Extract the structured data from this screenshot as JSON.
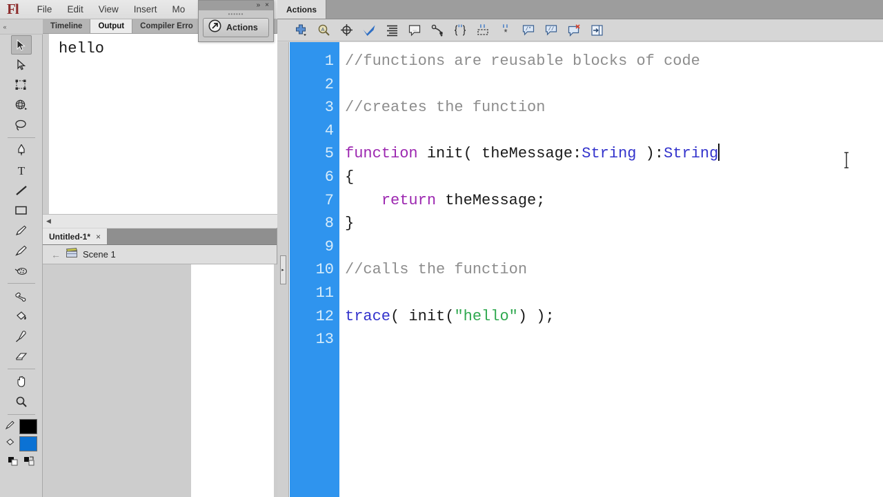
{
  "app": {
    "logo": "Fl",
    "menus": [
      "File",
      "Edit",
      "View",
      "Insert",
      "Mo"
    ]
  },
  "toolbox": {
    "collapse_label": "«",
    "tools": [
      {
        "name": "selection-tool",
        "label": "Selection Tool",
        "active": true
      },
      {
        "name": "subselection-tool",
        "label": "Subselection Tool",
        "active": false
      },
      {
        "name": "free-transform-tool",
        "label": "Free Transform Tool",
        "active": false
      },
      {
        "name": "3d-rotation-tool",
        "label": "3D Rotation Tool",
        "active": false
      },
      {
        "name": "lasso-tool",
        "label": "Lasso Tool",
        "active": false
      },
      {
        "name": "pen-tool",
        "label": "Pen Tool",
        "active": false
      },
      {
        "name": "text-tool",
        "label": "Text Tool",
        "active": false
      },
      {
        "name": "line-tool",
        "label": "Line Tool",
        "active": false
      },
      {
        "name": "rectangle-tool",
        "label": "Rectangle Tool",
        "active": false
      },
      {
        "name": "pencil-tool",
        "label": "Pencil Tool",
        "active": false
      },
      {
        "name": "brush-tool",
        "label": "Brush Tool",
        "active": false
      },
      {
        "name": "spray-brush-tool",
        "label": "Spray Brush Tool",
        "active": false
      },
      {
        "name": "bone-tool",
        "label": "Bone Tool",
        "active": false
      },
      {
        "name": "paint-bucket-tool",
        "label": "Paint Bucket Tool",
        "active": false
      },
      {
        "name": "eyedropper-tool",
        "label": "Eyedropper Tool",
        "active": false
      },
      {
        "name": "eraser-tool",
        "label": "Eraser Tool",
        "active": false
      },
      {
        "name": "hand-tool",
        "label": "Hand Tool",
        "active": false
      },
      {
        "name": "zoom-tool",
        "label": "Zoom Tool",
        "active": false
      }
    ],
    "colors": {
      "stroke_label": "Stroke color",
      "stroke_hex": "#000000",
      "fill_label": "Fill color",
      "fill_hex": "#0b72d4"
    }
  },
  "panel_group": {
    "tabs": [
      {
        "label": "Timeline",
        "active": false
      },
      {
        "label": "Output",
        "active": true
      },
      {
        "label": "Compiler Erro",
        "active": false
      }
    ],
    "output_text": "hello",
    "hscroll_arrow": "◀"
  },
  "document": {
    "tab_label": "Untitled-1*",
    "tab_close": "×",
    "back_arrow": "←",
    "scene_label": "Scene 1"
  },
  "float_panel": {
    "expand_label": "»",
    "close_label": "×",
    "grip": "••••••",
    "action_label": "Actions"
  },
  "actions": {
    "tab_label": "Actions",
    "toolbar": [
      {
        "name": "add-item-icon",
        "label": "Add a new item to the script"
      },
      {
        "name": "find-icon",
        "label": "Find"
      },
      {
        "name": "insert-target-path-icon",
        "label": "Insert target path"
      },
      {
        "name": "check-syntax-icon",
        "label": "Check syntax"
      },
      {
        "name": "auto-format-icon",
        "label": "Auto format"
      },
      {
        "name": "show-code-hint-icon",
        "label": "Show code hint"
      },
      {
        "name": "debug-options-icon",
        "label": "Debug options"
      },
      {
        "name": "collapse-between-braces-icon",
        "label": "Collapse between braces"
      },
      {
        "name": "collapse-selection-icon",
        "label": "Collapse selection"
      },
      {
        "name": "expand-all-icon",
        "label": "Expand all"
      },
      {
        "name": "apply-block-comment-icon",
        "label": "Apply block comment"
      },
      {
        "name": "apply-line-comment-icon",
        "label": "Apply line comment"
      },
      {
        "name": "remove-comment-icon",
        "label": "Remove comment"
      },
      {
        "name": "show-toolbox-icon",
        "label": "Show/Hide Toolbox"
      }
    ],
    "splitter_arrow": "▸",
    "line_numbers": [
      "1",
      "2",
      "3",
      "4",
      "5",
      "6",
      "7",
      "8",
      "9",
      "10",
      "11",
      "12",
      "13"
    ],
    "code_lines": [
      [
        {
          "t": "//functions are reusable blocks of code",
          "c": "cmt"
        }
      ],
      [],
      [
        {
          "t": "//creates the function",
          "c": "cmt"
        }
      ],
      [],
      [
        {
          "t": "function",
          "c": "kw"
        },
        {
          "t": " init( theMessage:",
          "c": "pln"
        },
        {
          "t": "String",
          "c": "typ"
        },
        {
          "t": " ):",
          "c": "pln"
        },
        {
          "t": "String",
          "c": "typ"
        },
        {
          "t": "|CARET|",
          "c": "caret"
        }
      ],
      [
        {
          "t": "{",
          "c": "pln"
        }
      ],
      [
        {
          "t": "    ",
          "c": "pln"
        },
        {
          "t": "return",
          "c": "kw"
        },
        {
          "t": " theMessage;",
          "c": "pln"
        }
      ],
      [
        {
          "t": "}",
          "c": "pln"
        }
      ],
      [],
      [
        {
          "t": "//calls the function",
          "c": "cmt"
        }
      ],
      [],
      [
        {
          "t": "trace",
          "c": "fn"
        },
        {
          "t": "( init(",
          "c": "pln"
        },
        {
          "t": "\"hello\"",
          "c": "str"
        },
        {
          "t": ") );",
          "c": "pln"
        }
      ],
      []
    ],
    "colors": {
      "gutter_bg": "#2f94ee",
      "gutter_fg": "#d6ecfb",
      "comment": "#8d8d8d",
      "keyword": "#9c27b0",
      "type": "#3333cc",
      "string": "#2fa84f",
      "plain": "#1a1a1a"
    }
  }
}
